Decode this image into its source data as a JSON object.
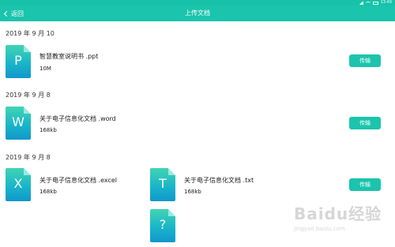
{
  "status_bar": {
    "time": "13:49",
    "signal_icon": "signal-icon",
    "wifi_icon": "wifi-icon",
    "battery_icon": "battery-icon"
  },
  "header": {
    "back_label": "返回",
    "title": "上传文档",
    "back_icon": "chevron-left-icon"
  },
  "groups": [
    {
      "date": "2019 年 9 月 10"
    },
    {
      "date": "2019 年 9 月 8"
    },
    {
      "date": "2019 年 9 月 8"
    }
  ],
  "files": [
    {
      "letter": "P",
      "name": "智慧教室说明书 .ppt",
      "size": "10M"
    },
    {
      "letter": "W",
      "name": "关于电子信息化文档 .word",
      "size": "168kb"
    },
    {
      "letter": "X",
      "name": "关于电子信息化文档 .excel",
      "size": "168kb"
    },
    {
      "letter": "T",
      "name": "关于电子信息化文档 .txt",
      "size": "168kb"
    },
    {
      "letter": "?"
    }
  ],
  "actions": {
    "transfer_label": "传输"
  },
  "watermark": {
    "main": "Baidu经验",
    "sub": "jingyan.baidu.com"
  },
  "colors": {
    "accent": "#1bc4ac",
    "icon_top": "#41d4b3",
    "icon_bottom": "#1097cb"
  }
}
